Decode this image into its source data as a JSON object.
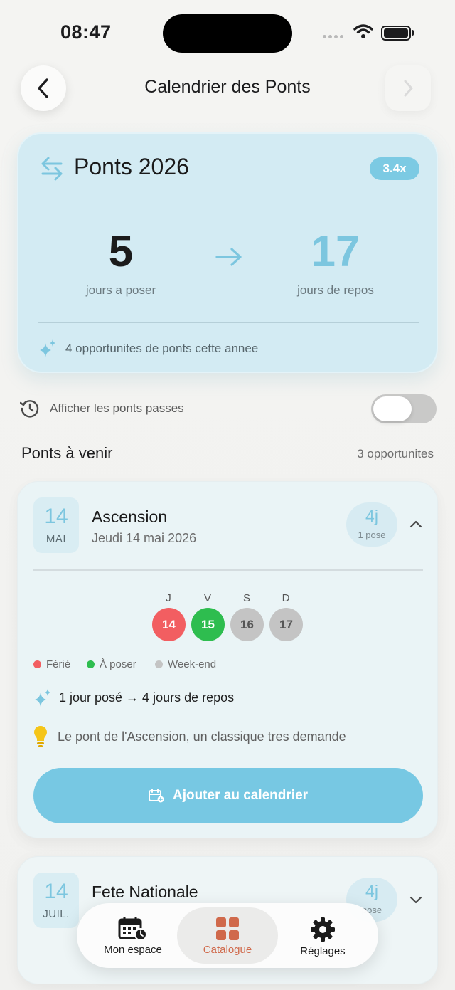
{
  "status_bar": {
    "time": "08:47"
  },
  "header": {
    "title": "Calendrier des Ponts",
    "back_icon": "chevron-left-icon",
    "forward_icon": "chevron-right-icon"
  },
  "summary": {
    "title": "Ponts 2026",
    "ratio": "3.4x",
    "days_to_take": "5",
    "days_to_take_label": "jours a poser",
    "days_off": "17",
    "days_off_label": "jours de repos",
    "opportunities_text": "4 opportunites de ponts cette annee",
    "accent": "#7cc6df"
  },
  "past_toggle": {
    "label": "Afficher les ponts passes",
    "on": false
  },
  "upcoming": {
    "title": "Ponts à venir",
    "count": "3 opportunites"
  },
  "bridges": [
    {
      "day": "14",
      "month": "MAI",
      "name": "Ascension",
      "date_long": "Jeudi 14 mai 2026",
      "days": "4j",
      "poses": "1 pose",
      "expanded": true,
      "calendar": [
        {
          "dow": "J",
          "num": "14",
          "kind": "ferie"
        },
        {
          "dow": "V",
          "num": "15",
          "kind": "poser"
        },
        {
          "dow": "S",
          "num": "16",
          "kind": "weekend"
        },
        {
          "dow": "D",
          "num": "17",
          "kind": "weekend"
        }
      ],
      "legend": {
        "ferie": "Férié",
        "poser": "À poser",
        "weekend": "Week-end"
      },
      "gain": "1 jour posé → 4 jours de repos",
      "tip": "Le pont de l'Ascension, un classique tres demande",
      "add_button": "Ajouter au calendrier"
    },
    {
      "day": "14",
      "month": "JUIL.",
      "name": "Fete Nationale",
      "days": "4j",
      "poses": "pose",
      "expanded": false
    }
  ],
  "colors": {
    "ferie": "#f25e61",
    "poser": "#2ebd4f",
    "weekend": "#c4c4c4",
    "active_tab": "#d0694b"
  },
  "tabbar": [
    {
      "label": "Mon espace",
      "icon": "calendar-clock-icon",
      "active": false
    },
    {
      "label": "Catalogue",
      "icon": "grid-icon",
      "active": true
    },
    {
      "label": "Réglages",
      "icon": "gear-icon",
      "active": false
    }
  ]
}
